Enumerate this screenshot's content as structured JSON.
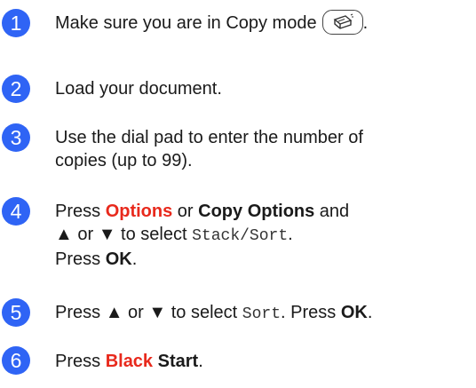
{
  "steps": [
    {
      "number": "1",
      "text": "Make sure you are in Copy mode",
      "end": "."
    },
    {
      "number": "2",
      "text": "Load your document."
    },
    {
      "number": "3",
      "line1": "Use the dial pad to enter the number of",
      "line2": "copies (up to 99)."
    },
    {
      "number": "4",
      "press": "Press ",
      "options": "Options",
      "or": " or ",
      "copy_options": "Copy Options",
      "and": " and",
      "up_arrow": "▲",
      "or2": " or ",
      "down_arrow": "▼",
      "to_select": " to select ",
      "stack_sort": "Stack/Sort",
      "period": ".",
      "press2": "Press ",
      "ok": "OK",
      "period2": "."
    },
    {
      "number": "5",
      "press": "Press ",
      "up_arrow": "▲",
      "or": " or ",
      "down_arrow": "▼",
      "to_select": " to select ",
      "sort": "Sort",
      "press_ok": ". Press ",
      "ok": "OK",
      "period": "."
    },
    {
      "number": "6",
      "press": "Press ",
      "black": "Black",
      "start": "Start",
      "period": "."
    }
  ],
  "icons": {
    "copy_mode": "copy-mode-button-icon",
    "step_color": "#2f64f5",
    "highlight_color": "#e8291c"
  }
}
